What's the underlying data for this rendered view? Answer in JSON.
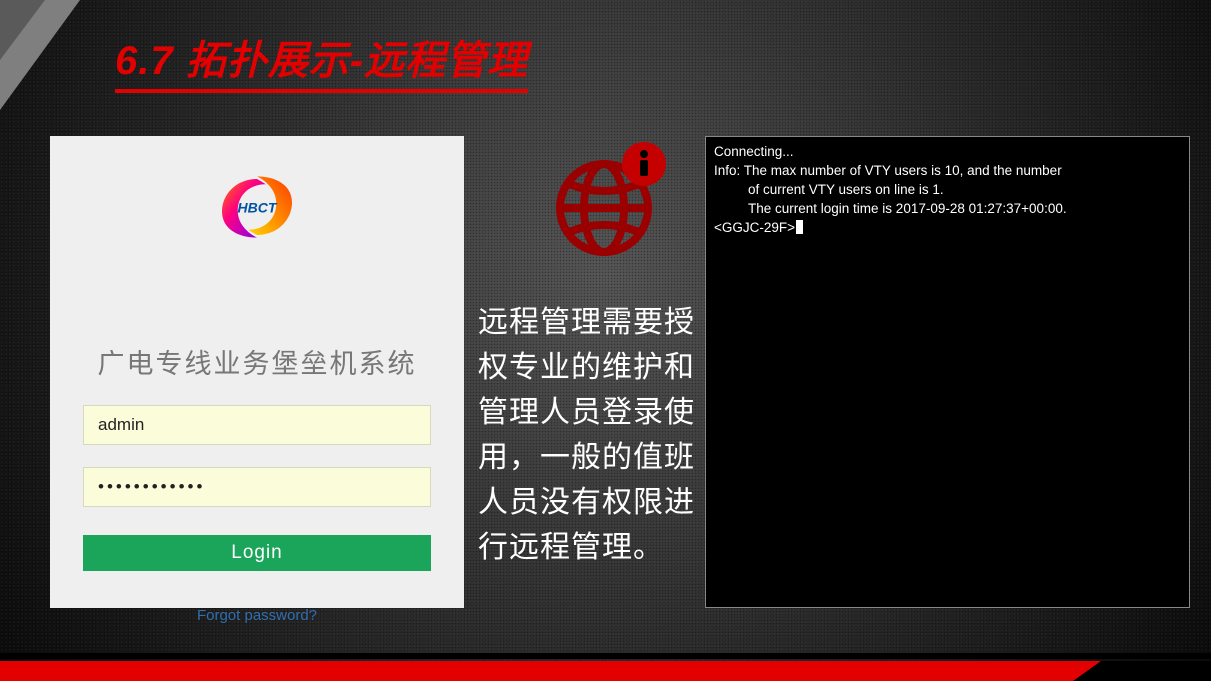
{
  "slide": {
    "title": "6.7  拓扑展示-远程管理"
  },
  "login": {
    "logo_text": "HBCT",
    "system_name": "广电专线业务堡垒机系统",
    "username_value": "admin",
    "password_value": "••••••••••••",
    "login_button": "Login",
    "forgot_link": "Forgot password?"
  },
  "icon": {
    "globe": "globe-info-icon"
  },
  "description": "远程管理需要授权专业的维护和管理人员登录使用，一般的值班人员没有权限进行远程管理。",
  "terminal": {
    "line1": "Connecting...",
    "line2": "Info: The max number of VTY users is 10, and the number",
    "line3": "of current VTY users on line is 1.",
    "line4": "The current login time is 2017-09-28 01:27:37+00:00.",
    "prompt": "<GGJC-29F>"
  }
}
